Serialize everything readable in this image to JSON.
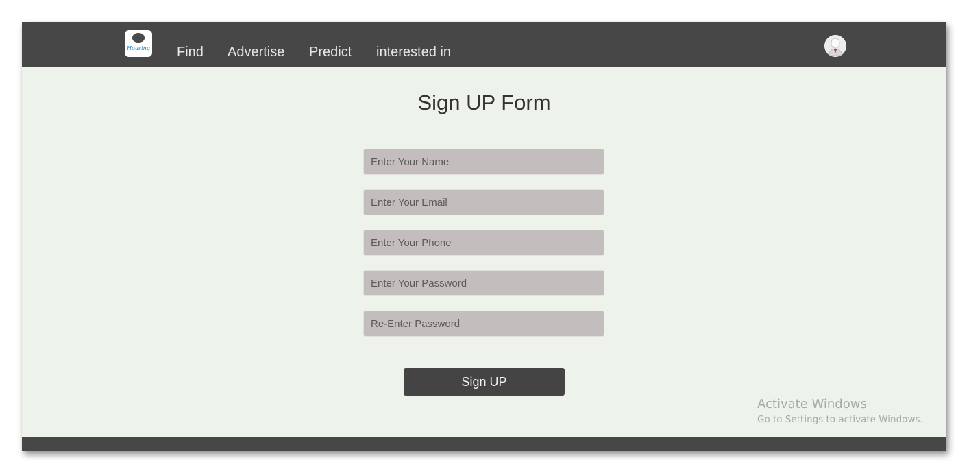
{
  "navbar": {
    "logo_text": "Housing",
    "links": [
      {
        "label": "Find"
      },
      {
        "label": "Advertise"
      },
      {
        "label": "Predict"
      },
      {
        "label": "interested in"
      }
    ],
    "avatar_icon": "user-avatar-icon"
  },
  "form": {
    "title": "Sign UP Form",
    "fields": [
      {
        "placeholder": "Enter Your Name",
        "value": ""
      },
      {
        "placeholder": "Enter Your Email",
        "value": ""
      },
      {
        "placeholder": "Enter Your Phone",
        "value": ""
      },
      {
        "placeholder": "Enter Your Password",
        "value": ""
      },
      {
        "placeholder": "Re-Enter Password",
        "value": ""
      }
    ],
    "submit_label": "Sign UP"
  },
  "watermark": {
    "title": "Activate Windows",
    "subtitle": "Go to Settings to activate Windows."
  },
  "colors": {
    "navbar": "#474747",
    "background": "#edf2ea",
    "field": "#c3bdbd",
    "button": "#444444",
    "logo_text": "#1e88c8"
  }
}
